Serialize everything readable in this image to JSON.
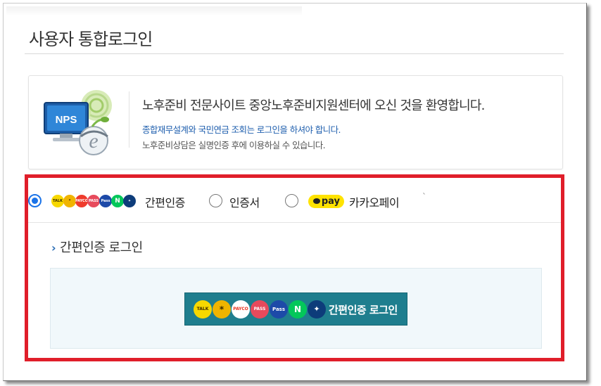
{
  "page": {
    "title": "사용자 통합로그인"
  },
  "welcome": {
    "heading": "노후준비 전문사이트 중앙노후준비지원센터에 오신 것을 환영합니다.",
    "sub": "종합재무설계와 국민연금 조회는 로그인을 하셔야 합니다.",
    "note": "노후준비상담은 실명인증 후에 이용하실 수 있습니다.",
    "logo_text": "NPS"
  },
  "auth_methods": {
    "selected": "simple",
    "options": [
      {
        "id": "simple",
        "label": "간편인증"
      },
      {
        "id": "cert",
        "label": "인증서"
      },
      {
        "id": "kakao",
        "label": "카카오페이",
        "badge": "pay"
      }
    ],
    "provider_icons": [
      "kakao-talk",
      "toss",
      "payco",
      "pass",
      "samsung-pass",
      "naver",
      "shinhan"
    ]
  },
  "simple_login": {
    "section_title": "간편인증 로그인",
    "button_label": "간편인증 로그인",
    "icon_texts": {
      "kakao": "TALK",
      "payco": "PAYCO",
      "pass": "PASS",
      "samsung": "Pass",
      "naver": "N"
    }
  },
  "colors": {
    "highlight_border": "#e01e2a",
    "button_bg": "#1f7e8e",
    "radio_selected": "#1a73e8",
    "link_blue": "#1f5fae"
  }
}
